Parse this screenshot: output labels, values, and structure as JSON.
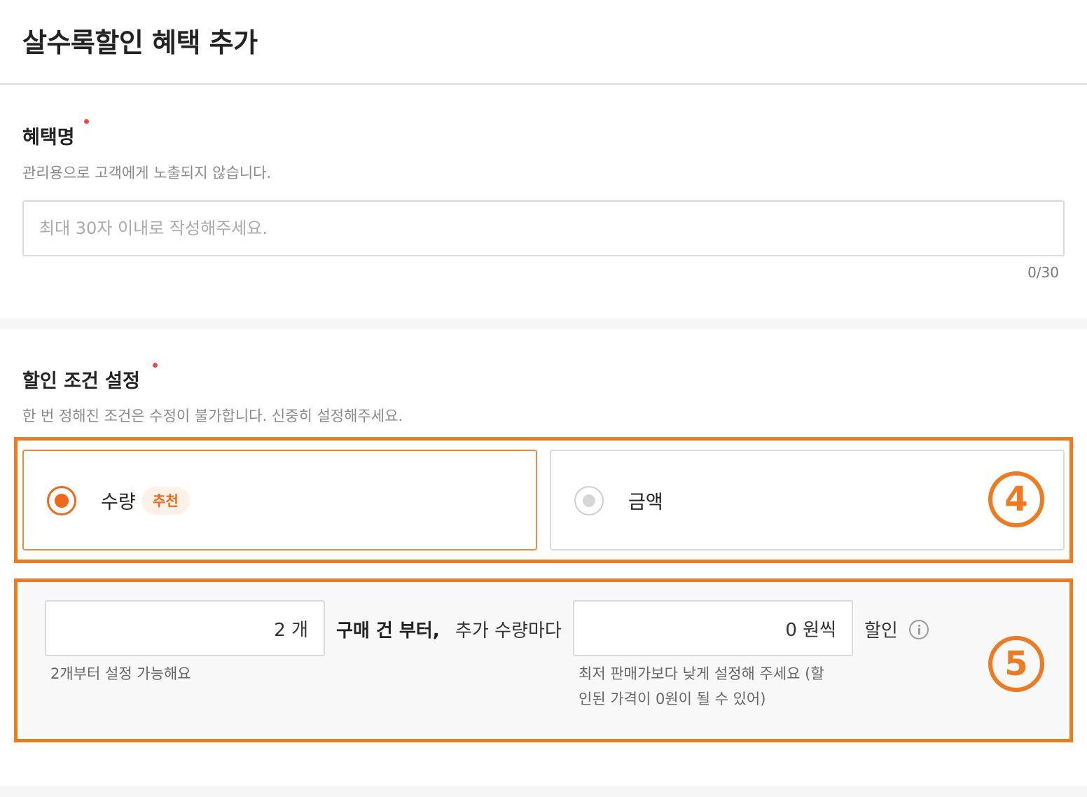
{
  "header": {
    "title": "살수록할인 혜택 추가"
  },
  "benefit_name": {
    "title": "혜택명",
    "description": "관리용으로 고객에게 노출되지 않습니다.",
    "input": {
      "value": "",
      "placeholder": "최대 30자 이내로 작성해주세요."
    },
    "counter": "0/30"
  },
  "discount_condition": {
    "title": "할인 조건 설정",
    "description": "한 번 정해진 조건은 수정이 불가합니다. 신중히 설정해주세요.",
    "options": [
      {
        "label": "수량",
        "badge": "추천",
        "selected": true
      },
      {
        "label": "금액",
        "selected": false
      }
    ],
    "condition": {
      "min_quantity": "2 개",
      "text_from": "구매 건 부터,",
      "text_per": "추가 수량마다",
      "discount_amount": "0 원씩",
      "text_discount": "할인",
      "min_hint": "2개부터 설정 가능해요",
      "amount_hint_line1": "최저 판매가보다 낮게 설정해 주세요 (할",
      "amount_hint_line2": "인된 가격이 0원이 될 수 있어)"
    }
  },
  "annotations": {
    "box4": "4",
    "box5": "5"
  },
  "colors": {
    "accent": "#ee6a1a",
    "annotation": "#ee7a22",
    "required": "#ef4a4a"
  }
}
